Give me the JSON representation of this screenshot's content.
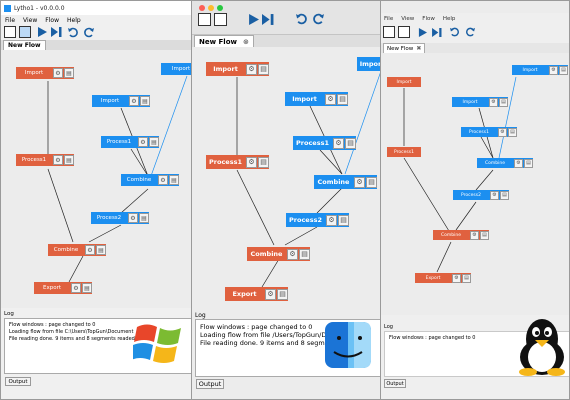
{
  "windows_version": {
    "title": "Lytho1 - v0.0.0.0",
    "menu": [
      "File",
      "View",
      "Flow",
      "Help"
    ],
    "tab_label": "New Flow",
    "log_header": "Log",
    "log_lines": [
      "Flow windows : page changed to 0",
      "Loading flow from file C:\\Users\\TopGun\\Document",
      "File reading done. 9 items and 8 segments readed."
    ],
    "output_tab": "Output"
  },
  "mac_version": {
    "tab_label": "New Flow",
    "log_header": "Log",
    "log_lines": [
      "Flow windows : page changed to 0",
      "Loading flow from file /Users/TopGun/Doc",
      "File reading done. 9 items and 8 segments"
    ],
    "output_tab": "Output"
  },
  "linux_version": {
    "menu": [
      "File",
      "View",
      "Flow",
      "Help"
    ],
    "tab_label": "New Flow",
    "log_header": "Log",
    "log_lines": [
      "Flow windows : page changed to 0"
    ],
    "output_tab": "Output"
  },
  "flow_nodes": [
    {
      "id": "import_left",
      "label": "Import",
      "color": "#e0613f"
    },
    {
      "id": "import_right",
      "label": "Import",
      "color": "#1c8ff0"
    },
    {
      "id": "import_mid",
      "label": "Import",
      "color": "#1c8ff0"
    },
    {
      "id": "process1_blue",
      "label": "Process1",
      "color": "#1c8ff0"
    },
    {
      "id": "process1_orange",
      "label": "Process1",
      "color": "#e0613f"
    },
    {
      "id": "combine_blue",
      "label": "Combine",
      "color": "#1c8ff0"
    },
    {
      "id": "process2",
      "label": "Process2",
      "color": "#1c8ff0"
    },
    {
      "id": "combine_orange",
      "label": "Combine",
      "color": "#e0613f"
    },
    {
      "id": "export",
      "label": "Export",
      "color": "#e0613f"
    }
  ],
  "icons": [
    "gear-icon",
    "document-icon",
    "play-icon",
    "step-forward-icon",
    "undo-icon",
    "redo-icon",
    "window-single-icon",
    "window-split-icon",
    "windows-logo-icon",
    "mac-finder-icon",
    "linux-tux-icon"
  ]
}
